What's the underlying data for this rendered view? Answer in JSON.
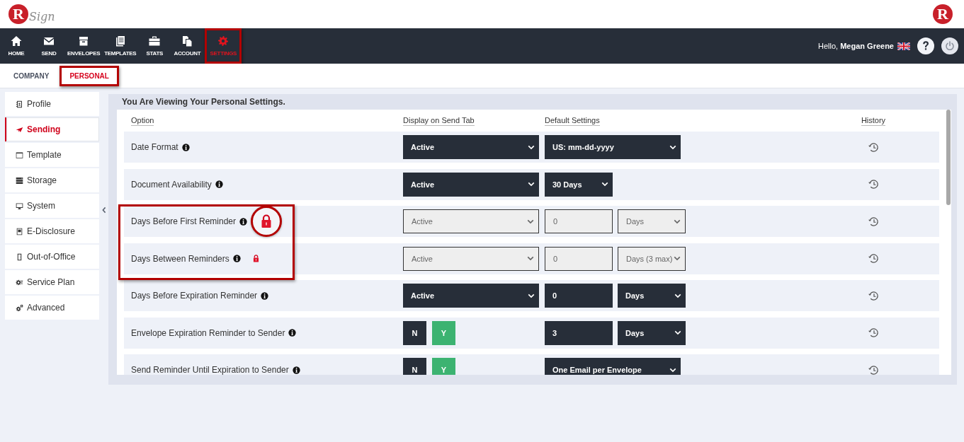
{
  "logo": {
    "mark": "R",
    "word": "Sign"
  },
  "brand_mark": "R",
  "nav": [
    {
      "label": "HOME",
      "selected": false,
      "highlighted": false
    },
    {
      "label": "SEND",
      "selected": false,
      "highlighted": false
    },
    {
      "label": "ENVELOPES",
      "selected": false,
      "highlighted": false
    },
    {
      "label": "TEMPLATES",
      "selected": false,
      "highlighted": false
    },
    {
      "label": "STATS",
      "selected": false,
      "highlighted": false
    },
    {
      "label": "ACCOUNT",
      "selected": false,
      "highlighted": false
    },
    {
      "label": "SETTINGS",
      "selected": true,
      "highlighted": true
    }
  ],
  "greeting": "Hello, **Megan Greene**",
  "subtabs": [
    {
      "label": "COMPANY",
      "selected": false,
      "highlighted": false
    },
    {
      "label": "PERSONAL",
      "selected": true,
      "highlighted": true
    }
  ],
  "sidebar": {
    "items": [
      {
        "label": "Profile",
        "selected": false
      },
      {
        "label": "Sending",
        "selected": true
      },
      {
        "label": "Template",
        "selected": false
      },
      {
        "label": "Storage",
        "selected": false
      },
      {
        "label": "System",
        "selected": false
      },
      {
        "label": "E-Disclosure",
        "selected": false
      },
      {
        "label": "Out-of-Office",
        "selected": false
      },
      {
        "label": "Service Plan",
        "selected": false
      },
      {
        "label": "Advanced",
        "selected": false
      }
    ]
  },
  "panel": {
    "title": "You Are Viewing Your Personal Settings.",
    "columns": [
      "Option",
      "Display on Send Tab",
      "Default Settings",
      "History"
    ],
    "rows": [
      {
        "label": "Date Format",
        "locked": false,
        "boxed": false,
        "display": {
          "kind": "select",
          "value": "Active",
          "disabled": false
        },
        "defaults": [
          {
            "kind": "select-wide",
            "value": "US: mm-dd-yyyy",
            "disabled": false
          }
        ]
      },
      {
        "label": "Document Availability",
        "locked": false,
        "boxed": false,
        "display": {
          "kind": "select",
          "value": "Active",
          "disabled": false
        },
        "defaults": [
          {
            "kind": "select",
            "value": "30 Days",
            "disabled": false
          }
        ]
      },
      {
        "label": "Days Before First Reminder",
        "locked": true,
        "lock_circled": true,
        "boxed": true,
        "display": {
          "kind": "select",
          "value": "Active",
          "disabled": true
        },
        "defaults": [
          {
            "kind": "input",
            "value": "0",
            "disabled": true
          },
          {
            "kind": "select",
            "value": "Days",
            "disabled": true
          }
        ]
      },
      {
        "label": "Days Between Reminders",
        "locked": true,
        "lock_circled": false,
        "boxed": true,
        "display": {
          "kind": "select",
          "value": "Active",
          "disabled": true
        },
        "defaults": [
          {
            "kind": "input",
            "value": "0",
            "disabled": true
          },
          {
            "kind": "select",
            "value": "Days (3 max)",
            "disabled": true
          }
        ]
      },
      {
        "label": "Days Before Expiration Reminder",
        "locked": false,
        "boxed": false,
        "display": {
          "kind": "select",
          "value": "Active",
          "disabled": false
        },
        "defaults": [
          {
            "kind": "input",
            "value": "0",
            "disabled": false
          },
          {
            "kind": "select",
            "value": "Days",
            "disabled": false
          }
        ]
      },
      {
        "label": "Envelope Expiration Reminder to Sender",
        "locked": false,
        "boxed": false,
        "display": {
          "kind": "toggle",
          "options": [
            {
              "label": "N",
              "selected": false
            },
            {
              "label": "Y",
              "selected": true
            }
          ]
        },
        "defaults": [
          {
            "kind": "input",
            "value": "3",
            "disabled": false
          },
          {
            "kind": "select",
            "value": "Days",
            "disabled": false
          }
        ]
      },
      {
        "label": "Send Reminder Until Expiration to Sender",
        "locked": false,
        "boxed": false,
        "display": {
          "kind": "toggle",
          "options": [
            {
              "label": "N",
              "selected": false
            },
            {
              "label": "Y",
              "selected": true
            }
          ]
        },
        "defaults": [
          {
            "kind": "select-wide",
            "value": "One Email per Envelope",
            "disabled": false
          }
        ]
      }
    ]
  }
}
